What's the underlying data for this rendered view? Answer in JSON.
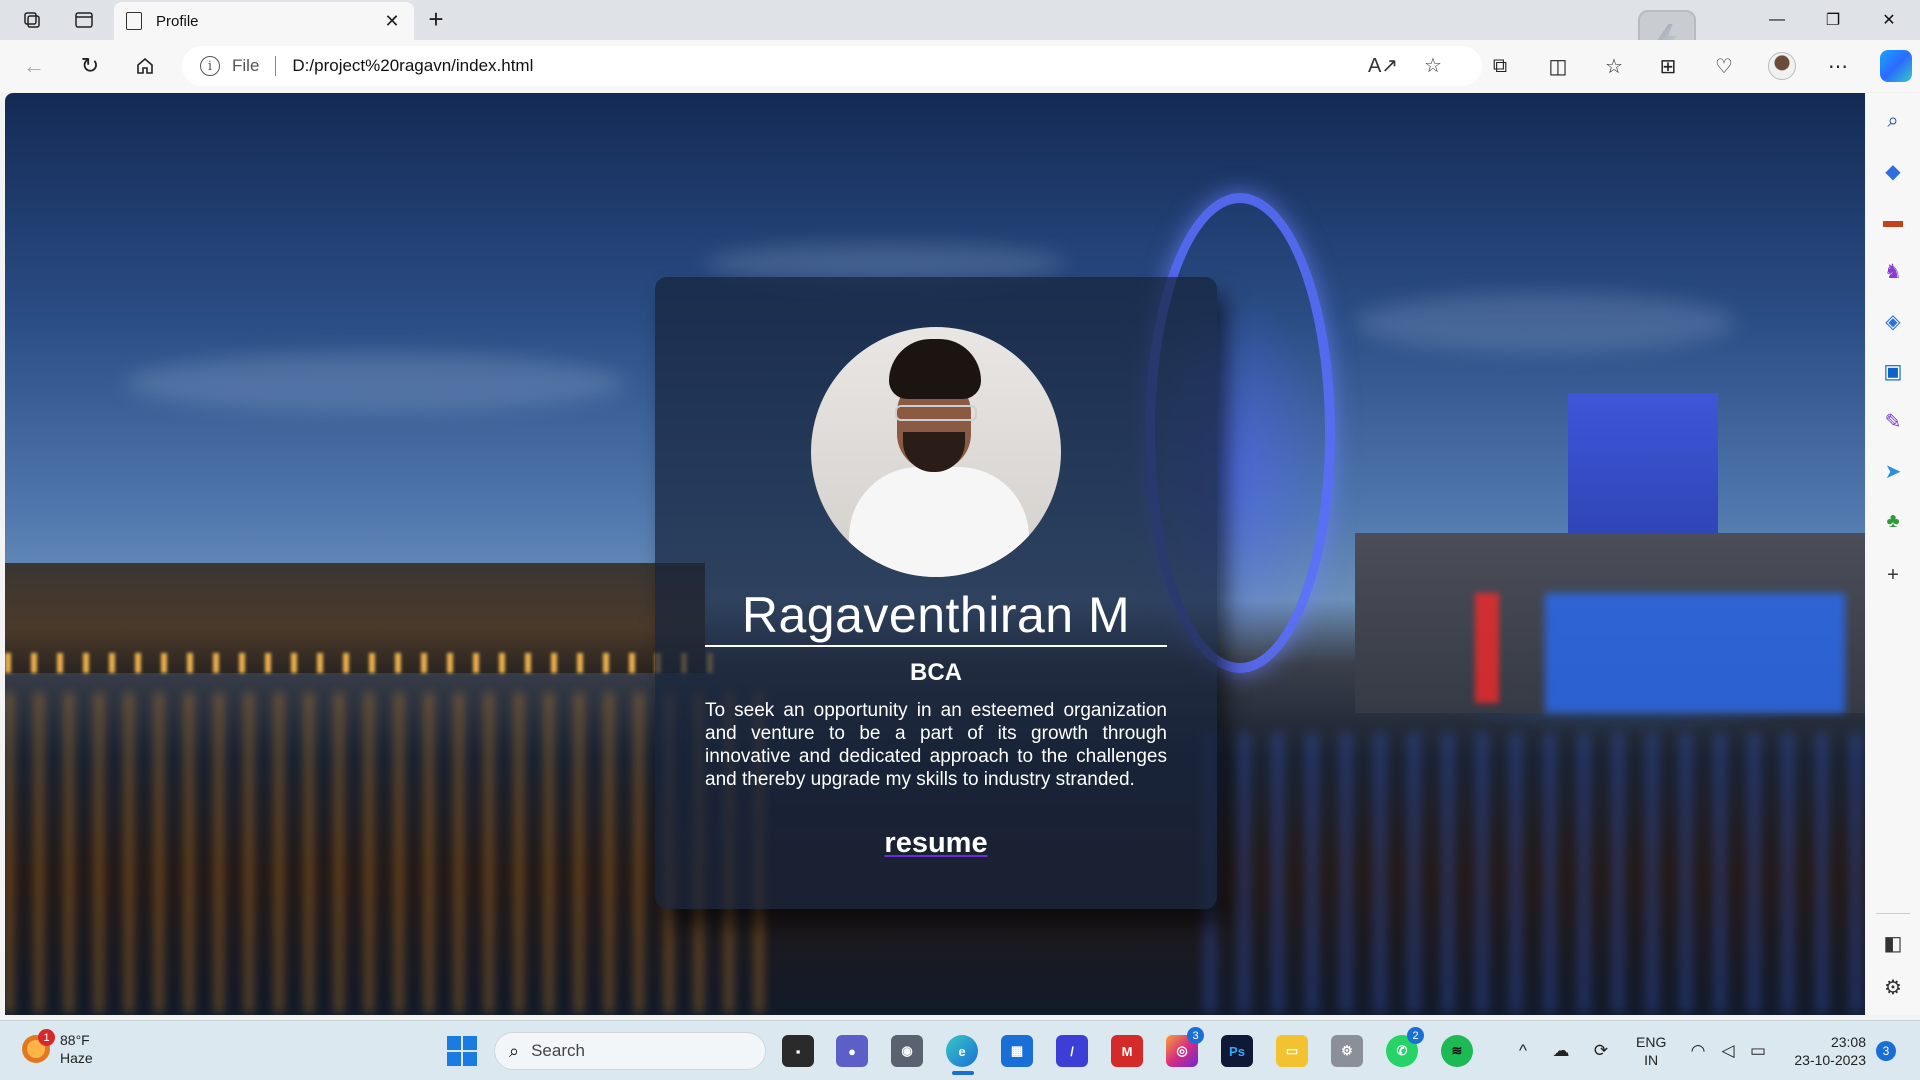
{
  "browser": {
    "tab": {
      "title": "Profile"
    },
    "address": {
      "scheme_label": "File",
      "url": "D:/project%20ragavn/index.html"
    }
  },
  "page": {
    "name": "Ragaventhiran M",
    "degree": "BCA",
    "objective": "To seek an opportunity in an esteemed organization and venture to be a part of its growth through innovative and dedicated approach to the challenges and thereby upgrade my skills to industry stranded.",
    "resume_link": "resume"
  },
  "taskbar": {
    "weather": {
      "temp": "88°F",
      "condition": "Haze",
      "badge": "1"
    },
    "search_placeholder": "Search",
    "instagram_badge": "3",
    "whatsapp_badge": "2",
    "lang_top": "ENG",
    "lang_bottom": "IN",
    "time": "23:08",
    "date": "23-10-2023",
    "notification_count": "3"
  },
  "colors": {
    "accent": "#1a6fd6",
    "card_bg": "rgba(24,36,60,0.72)",
    "link_underline": "#6b2bd6"
  }
}
